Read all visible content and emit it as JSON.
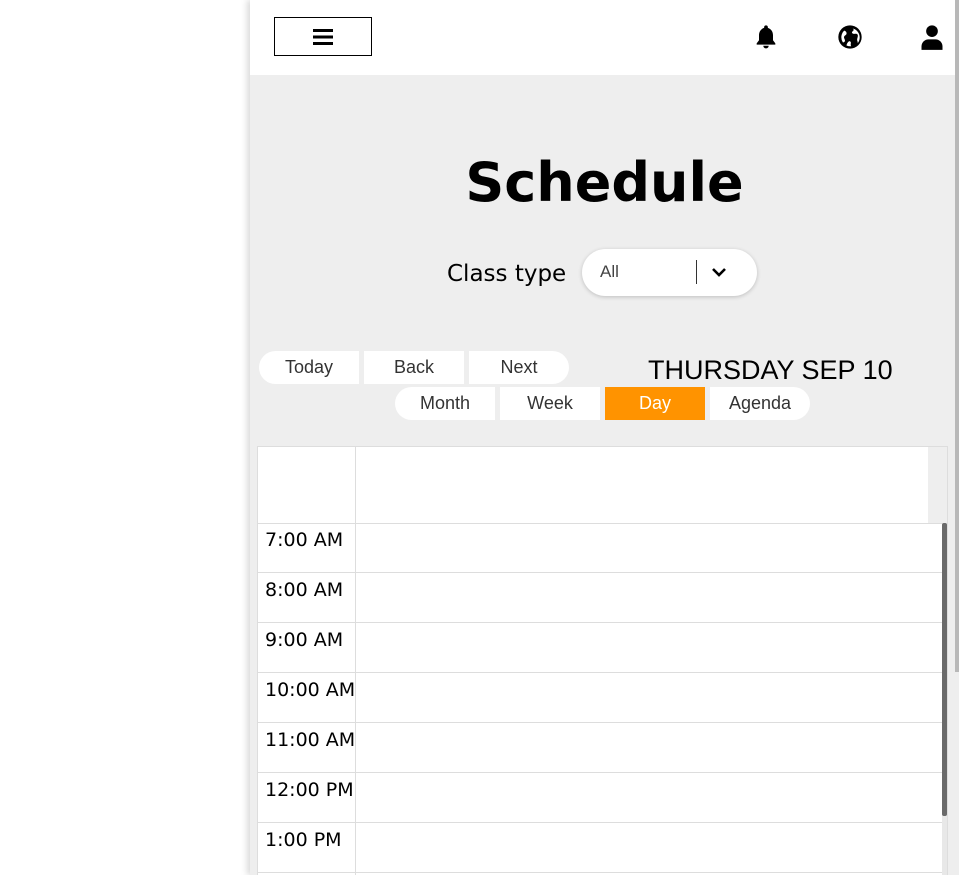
{
  "header": {
    "menu_icon": "hamburger-icon",
    "icons": [
      "bell-icon",
      "globe-icon",
      "user-icon"
    ]
  },
  "page": {
    "title": "Schedule"
  },
  "filter": {
    "label": "Class type",
    "selected": "All"
  },
  "toolbar": {
    "nav_buttons": [
      "Today",
      "Back",
      "Next"
    ],
    "date_label": "THURSDAY SEP 10",
    "view_buttons": [
      "Month",
      "Week",
      "Day",
      "Agenda"
    ],
    "active_view": "Day"
  },
  "calendar": {
    "time_slots": [
      "7:00 AM",
      "8:00 AM",
      "9:00 AM",
      "10:00 AM",
      "11:00 AM",
      "12:00 PM",
      "1:00 PM"
    ]
  },
  "colors": {
    "accent": "#ff9300",
    "background": "#eeeeee",
    "surface": "#ffffff"
  }
}
